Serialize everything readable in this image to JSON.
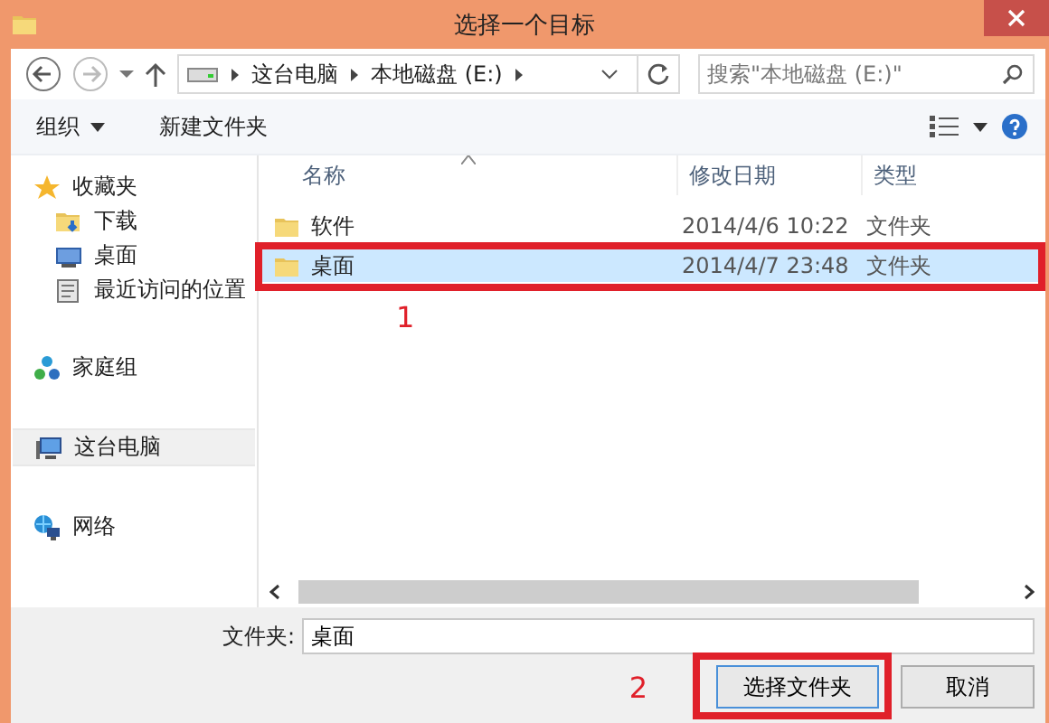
{
  "window": {
    "title": "选择一个目标"
  },
  "nav": {
    "breadcrumb": [
      "这台电脑",
      "本地磁盘 (E:)"
    ],
    "search": {
      "placeholder": "搜索\"本地磁盘 (E:)\""
    }
  },
  "toolbar": {
    "items": [
      {
        "label": "组织",
        "dropdown": true
      },
      {
        "label": "新建文件夹",
        "dropdown": false
      }
    ]
  },
  "sidebar": {
    "items": [
      {
        "label": "收藏夹",
        "kind": "favorites",
        "selected": false,
        "children": [
          {
            "label": "下载",
            "kind": "downloads",
            "selected": false
          },
          {
            "label": "桌面",
            "kind": "desktop",
            "selected": false
          },
          {
            "label": "最近访问的位置",
            "kind": "recent",
            "selected": false
          }
        ]
      },
      {
        "label": "家庭组",
        "kind": "homegroup",
        "selected": false
      },
      {
        "label": "这台电脑",
        "kind": "computer",
        "selected": true
      },
      {
        "label": "网络",
        "kind": "network",
        "selected": false
      }
    ]
  },
  "files": {
    "columns": [
      {
        "label": "名称",
        "sorted": true
      },
      {
        "label": "修改日期",
        "sorted": false
      },
      {
        "label": "类型",
        "sorted": false
      }
    ],
    "rows": [
      {
        "name": "软件",
        "modified": "2014/4/6 10:22",
        "type": "文件夹",
        "selected": false,
        "marked": false
      },
      {
        "name": "桌面",
        "modified": "2014/4/7 23:48",
        "type": "文件夹",
        "selected": true,
        "marked": true
      }
    ],
    "callout": "1"
  },
  "footer": {
    "folder_label": "文件夹:",
    "folder_value": "桌面",
    "callout": "2",
    "buttons": [
      {
        "label": "选择文件夹",
        "default": true,
        "marked": true
      },
      {
        "label": "取消",
        "default": false,
        "marked": false
      }
    ]
  }
}
